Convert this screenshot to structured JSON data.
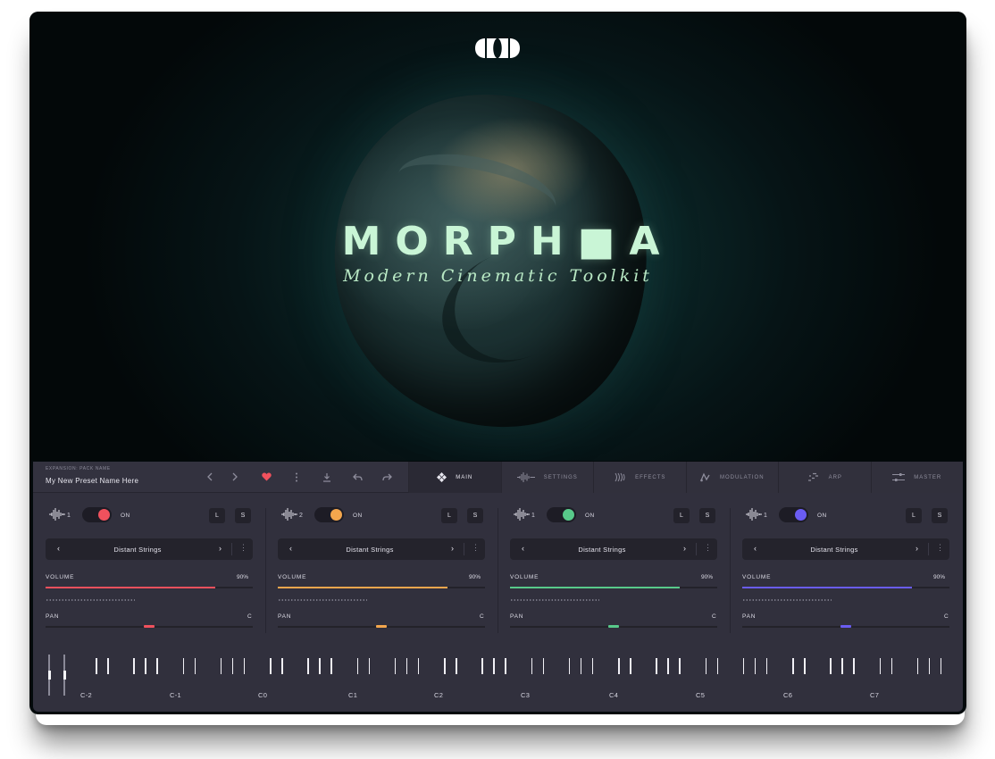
{
  "hero": {
    "title": "MORPH■A",
    "subtitle": "Modern Cinematic Toolkit"
  },
  "topbar": {
    "preset_category": "EXPANSION: PACK NAME",
    "preset_name": "My New Preset  Name Here",
    "icons": [
      "chevron-left-icon",
      "chevron-right-icon",
      "heart-icon",
      "more-icon",
      "download-icon",
      "undo-icon",
      "redo-icon"
    ]
  },
  "tabs": [
    {
      "label": "MAIN",
      "icon": "diamond-grid-icon",
      "active": true
    },
    {
      "label": "SETTINGS",
      "icon": "waveform-icon",
      "active": false
    },
    {
      "label": "EFFECTS",
      "icon": "radio-waves-icon",
      "active": false
    },
    {
      "label": "MODULATION",
      "icon": "modulation-icon",
      "active": false
    },
    {
      "label": "ARP",
      "icon": "arp-icon",
      "active": false
    },
    {
      "label": "MASTER",
      "icon": "sliders-icon",
      "active": false
    }
  ],
  "channels": [
    {
      "number": "1",
      "on_label": "ON",
      "color": "#f0515d",
      "l_label": "L",
      "s_label": "S",
      "preset": "Distant Strings",
      "volume_label": "VOLUME",
      "volume_value": "90%",
      "volume_fraction": 0.82,
      "pan_label": "PAN",
      "pan_value": "C"
    },
    {
      "number": "2",
      "on_label": "ON",
      "color": "#f3a64d",
      "l_label": "L",
      "s_label": "S",
      "preset": "Distant Strings",
      "volume_label": "VOLUME",
      "volume_value": "90%",
      "volume_fraction": 0.82,
      "pan_label": "PAN",
      "pan_value": "C"
    },
    {
      "number": "1",
      "on_label": "ON",
      "color": "#58c98a",
      "l_label": "L",
      "s_label": "S",
      "preset": "Distant Strings",
      "volume_label": "VOLUME",
      "volume_value": "90%",
      "volume_fraction": 0.82,
      "pan_label": "PAN",
      "pan_value": "C"
    },
    {
      "number": "1",
      "on_label": "ON",
      "color": "#6a5cf2",
      "l_label": "L",
      "s_label": "S",
      "preset": "Distant Strings",
      "volume_label": "VOLUME",
      "volume_value": "90%",
      "volume_fraction": 0.82,
      "pan_label": "PAN",
      "pan_value": "C"
    }
  ],
  "keyboard": {
    "octaves": [
      "C-2",
      "C-1",
      "C0",
      "C1",
      "C2",
      "C3",
      "C4",
      "C5",
      "C6",
      "C7"
    ]
  }
}
